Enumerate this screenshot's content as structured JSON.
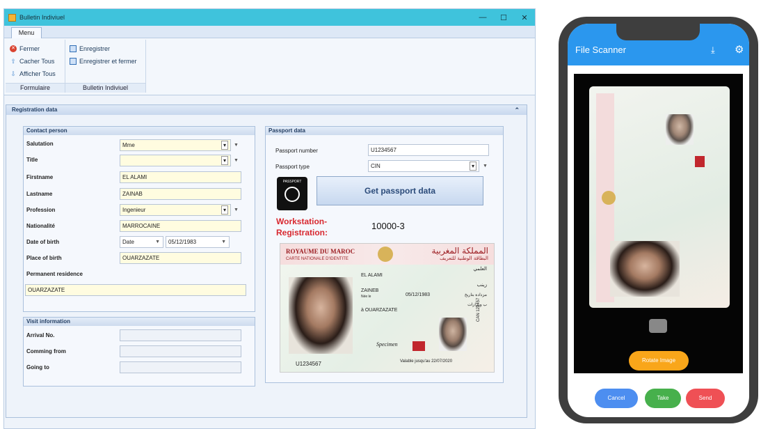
{
  "window": {
    "title": "Bulletin Indiviuel",
    "controls": [
      "—",
      "☐",
      "✕"
    ]
  },
  "ribbon": {
    "tab": "Menu",
    "groups": [
      {
        "label": "Formulaire",
        "items": [
          {
            "label": "Fermer",
            "icon": "close-icon"
          },
          {
            "label": "Cacher Tous",
            "icon": "up-arrow-icon"
          },
          {
            "label": "Afficher Tous",
            "icon": "down-arrow-icon"
          }
        ]
      },
      {
        "label": "Bulletin Indiviuel",
        "items": [
          {
            "label": "Enregistrer",
            "icon": "save-icon"
          },
          {
            "label": "Enregistrer et fermer",
            "icon": "save-close-icon"
          }
        ]
      }
    ]
  },
  "section": {
    "title": "Registration data"
  },
  "contact": {
    "title": "Contact person",
    "salutation_label": "Salutation",
    "salutation": "Mme",
    "title_label": "Title",
    "title_value": "",
    "firstname_label": "Firstname",
    "firstname": "EL ALAMI",
    "lastname_label": "Lastname",
    "lastname": "ZAINAB",
    "profession_label": "Profession",
    "profession": "Ingenieur",
    "nationality_label": "Nationalité",
    "nationality": "MARROCAINE",
    "dob_label": "Date of birth",
    "dob_type": "Date",
    "dob": "05/12/1983",
    "pob_label": "Place of birth",
    "pob": "OUARZAZATE",
    "residence_label": "Permanent residence",
    "residence": "OUARZAZATE"
  },
  "visit": {
    "title": "Visit information",
    "arrival_label": "Arrival No.",
    "coming_label": "Comming from",
    "going_label": "Going to"
  },
  "passport": {
    "title": "Passport data",
    "number_label": "Passport number",
    "number": "U1234567",
    "type_label": "Passport type",
    "type": "CIN",
    "badge": "PASSPORT",
    "button": "Get passport data",
    "ws_label_1": "Workstation-",
    "ws_label_2": "Registration:",
    "ws_value": "10000-3"
  },
  "card": {
    "country_fr": "ROYAUME DU MAROC",
    "subtitle_fr": "CARTE NATIONALE D'IDENTITE",
    "country_ar": "المملكة المغربية",
    "subtitle_ar": "البطاقة الوطنية للتعريف",
    "surname": "EL ALAMI",
    "surname_ar": "العلمي",
    "given": "ZAINEB",
    "given_ar": "زينب",
    "sex": "Née le",
    "dob_ar": "مزدادة بتاريخ",
    "dob": "05/12/1983",
    "place": "à OUARZAZATE",
    "place_ar": "ب ورزازات",
    "number": "U1234567",
    "valid": "Valable jusqu'au  22/07/2020",
    "specimen": "Specimen",
    "side_code": "CAN 123457"
  },
  "phone": {
    "title": "File Scanner",
    "rotate": "Rotate Image",
    "btn1": "Cancel",
    "btn2": "Take",
    "btn3": "Send",
    "colors": {
      "appbar": "#2b97ee",
      "rotate": "#f9a61a",
      "btn1": "#4d8ef0",
      "btn2": "#47b04c",
      "btn3": "#ef5055"
    }
  }
}
